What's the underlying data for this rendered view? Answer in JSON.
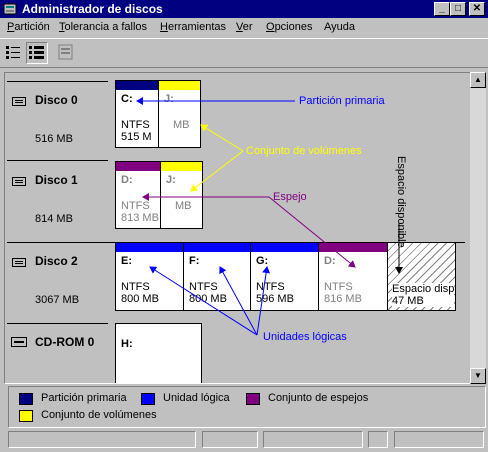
{
  "window": {
    "title": "Administrador de discos",
    "controls": {
      "minimize": "_",
      "maximize": "□",
      "close": "✕"
    }
  },
  "menu": [
    {
      "label_u": "P",
      "label_rest": "artición"
    },
    {
      "label_u": "T",
      "label_rest": "olerancia a fallos"
    },
    {
      "label_u": "H",
      "label_rest": "erramientas"
    },
    {
      "label_u": "V",
      "label_rest": "er"
    },
    {
      "label_u": "O",
      "label_rest": "pciones"
    },
    {
      "label_u": "",
      "label_rest": "Ayuda"
    }
  ],
  "toolbar": {
    "icons": [
      "volumes-view-icon",
      "disk-config-view-icon",
      "properties-icon"
    ]
  },
  "disks": [
    {
      "name": "Disco 0",
      "size": "516 MB"
    },
    {
      "name": "Disco 1",
      "size": "814 MB"
    },
    {
      "name": "Disco 2",
      "size": "3067 MB"
    },
    {
      "name": "CD-ROM 0",
      "size": ""
    }
  ],
  "partitions": {
    "d0_c": {
      "letter": "C:",
      "fs": "NTFS",
      "size": "515 M"
    },
    "d0_j": {
      "letter": "J:",
      "fs": "",
      "size": "MB"
    },
    "d1_d": {
      "letter": "D:",
      "fs": "NTFS",
      "size": "813 MB"
    },
    "d1_j": {
      "letter": "J:",
      "fs": "",
      "size": "MB"
    },
    "d2_e": {
      "letter": "E:",
      "fs": "NTFS",
      "size": "800 MB"
    },
    "d2_f": {
      "letter": "F:",
      "fs": "NTFS",
      "size": "800 MB"
    },
    "d2_g": {
      "letter": "G:",
      "fs": "NTFS",
      "size": "596 MB"
    },
    "d2_d": {
      "letter": "D:",
      "fs": "NTFS",
      "size": "816 MB"
    },
    "d2_free": {
      "label": "Espacio disp",
      "size": "47 MB"
    },
    "cd_h": {
      "letter": "H:"
    }
  },
  "callouts": {
    "primary": "Partición primaria",
    "volume_set": "Conjunto de volúmenes",
    "mirror": "Espejo",
    "free_space": "Espacio disponible",
    "logical": "Unidades lógicas"
  },
  "legend": [
    {
      "label": "Partición primaria",
      "color": "#000080"
    },
    {
      "label": "Unidad lógica",
      "color": "#0000ff"
    },
    {
      "label": "Conjunto de espejos",
      "color": "#800080"
    },
    {
      "label": "Conjunto de volúmenes",
      "color": "#ffff00"
    }
  ],
  "colors": {
    "primary": "#000080",
    "logical": "#0000ff",
    "mirror": "#800080",
    "volume": "#ffff00",
    "titlebar": "#000080"
  }
}
